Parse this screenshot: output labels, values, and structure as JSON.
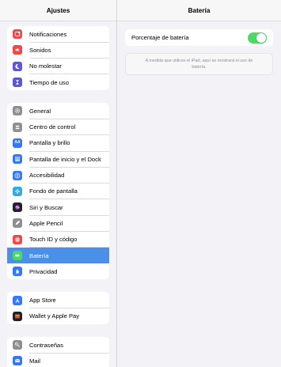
{
  "sidebar": {
    "title": "Ajustes",
    "groups": [
      [
        {
          "label": "Notificaciones",
          "icon": "notifications-icon",
          "color": "#f0484a"
        },
        {
          "label": "Sonidos",
          "icon": "sounds-icon",
          "color": "#f0484a"
        },
        {
          "label": "No molestar",
          "icon": "moon-icon",
          "color": "#5b57d6"
        },
        {
          "label": "Tiempo de uso",
          "icon": "hourglass-icon",
          "color": "#5b57d6"
        }
      ],
      [
        {
          "label": "General",
          "icon": "gear-icon",
          "color": "#8e8e93"
        },
        {
          "label": "Centro de control",
          "icon": "control-center-icon",
          "color": "#8e8e93"
        },
        {
          "label": "Pantalla y brillo",
          "icon": "display-icon",
          "color": "#3478f6"
        },
        {
          "label": "Pantalla de inicio y el Dock",
          "icon": "home-screen-icon",
          "color": "#3478f6"
        },
        {
          "label": "Accesibilidad",
          "icon": "accessibility-icon",
          "color": "#3478f6"
        },
        {
          "label": "Fondo de pantalla",
          "icon": "wallpaper-icon",
          "color": "#35aadc"
        },
        {
          "label": "Siri y Buscar",
          "icon": "siri-icon",
          "color": "#222222"
        },
        {
          "label": "Apple Pencil",
          "icon": "pencil-icon",
          "color": "#8e8e93"
        },
        {
          "label": "Touch ID y código",
          "icon": "fingerprint-icon",
          "color": "#f0484a"
        },
        {
          "label": "Batería",
          "icon": "battery-icon",
          "color": "#4cd964",
          "active": true
        },
        {
          "label": "Privacidad",
          "icon": "hand-icon",
          "color": "#3478f6"
        }
      ],
      [
        {
          "label": "App Store",
          "icon": "app-store-icon",
          "color": "#3478f6"
        },
        {
          "label": "Wallet y Apple Pay",
          "icon": "wallet-icon",
          "color": "#222222"
        }
      ],
      [
        {
          "label": "Contraseñas",
          "icon": "key-icon",
          "color": "#8e8e93"
        },
        {
          "label": "Mail",
          "icon": "mail-icon",
          "color": "#3478f6"
        }
      ]
    ]
  },
  "detail": {
    "title": "Batería",
    "battery_percentage": {
      "label": "Porcentaje de batería",
      "enabled": true
    },
    "note": "A medida que utilices el iPad, aquí se mostrará el uso de batería."
  },
  "colors": {
    "accent": "#4a90e8",
    "toggle_on": "#4cd964"
  }
}
